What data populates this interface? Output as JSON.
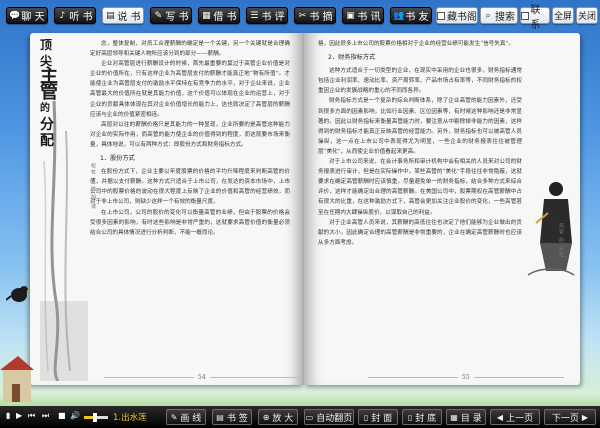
{
  "toolbar": {
    "items": [
      {
        "icon": "💬",
        "label": "聊 天"
      },
      {
        "icon": "♪",
        "label": "听 书"
      },
      {
        "icon": "▤",
        "label": "说 书"
      },
      {
        "icon": "✎",
        "label": "写 书"
      },
      {
        "icon": "▦",
        "label": "借 书"
      },
      {
        "icon": "☰",
        "label": "书 评"
      },
      {
        "icon": "✂",
        "label": "书 摘"
      },
      {
        "icon": "▣",
        "label": "书 讯"
      },
      {
        "icon": "👥",
        "label": "书 友"
      }
    ],
    "bookmark_label": "藏书阁",
    "search_label": "搜索",
    "contact_label": "联系",
    "fullscreen_label": "全屏",
    "close_label": "关闭"
  },
  "book": {
    "left_title": [
      "顶",
      "尖",
      "主",
      "管",
      "的",
      "分",
      "配"
    ],
    "left_side_text": "权杖 下 的 阴 谋",
    "left_paragraphs": [
      "念，整体复制，对员工合理薪酬的确定是一个关键，另一个关键就是合理确定好高层领导和关键人物所应该分到的部分——薪酬。",
      "企业对高管层进行薪酬设计的时候，首先最重要的莫过于高管企业价值是对企业的价值所在，只有这样企业为高管层支付的薪酬才能真正地“物有所值”。才能使企业为高管层支付的激励水平保持在有竞争力的水平，对于企业来说，企业高管最大的价值所在就是其能力价值，这个价值可以体现在企业的运营上，对于企业的贡献具体体现在其对企业价值增长的能力上，这也就决定了高管层的薪酬应该与企业的价值紧密相连。",
      "高层对以往的薪酬价格只是其能力的一种显现，企业所要的是高管这种能力对企业的实际作用，而高管的能力使企业的价值得到的程度，而这就要市场来衡量，具体地说，可以有两种方式：即股份方式和财务指标方式。"
    ],
    "left_heading": "1．股份方式",
    "left_paragraphs_2": [
      "在股份方式下，企业主要以年度股票的价格的平均升降程度来判断高管的价值，并据以支付薪酬。这种方式只适合于上市公司，在发达的资本市场中，上市公司中的股票价格的波动在很大程度上反映了企业的价值和高管的经营绩效，而对于非上市公司，则缺少这样一个有效的衡量尺度。",
      "在上市公司，公司的股价的变化可以衡量高管的业绩，但由于股票的价格会受很多因素的影响，有时这些影响是非常严重的，这就要求高管价值的衡量必须结合公司的具体情况进行分析判断，不能一概而论。"
    ],
    "left_page_num": "54",
    "right_paragraphs_1": [
      "格，因此很多上市公司的股票价格相对于企业的经营业绩可能发生“信号失真”。"
    ],
    "right_heading": "2．财务指标方式",
    "right_paragraphs_2": [
      "这种方式适合于一切类型的企业，在现实中采用的企业也很多，财务指标通常包括企业利润率、速动比率、资产周转率、产品市场占有率等，不同财务指标的权重因企业的发展战略的重心的不同而各异。",
      "财务指标方式是一个复杂的综合判断体系，除了企业高管的能力因素外，还受到很多方面的因素影响，比如行业因素、区位因素等，有时候这种影响还是非常显著的。因此以财务指标来衡量高管能力时，要注意从中剔除掉非能力的因素，这样得到的财务指标才能真正反映高管的经营能力。另外，财务指标也可以被高管人员操纵，这一点在上市公司中表现得尤为明显，一些企业的财务报表往往被管理层“美化”，从而使企业价值看起来更高。",
      "对于上市公司来说，在会计事务所和审计机构中会有相关的人员来对公司的财务报表进行审计，但是在实际操作中，某些高管的“美化”手段往往非常隐蔽，这就要求在确定高管薪酬时应该慎重，尽量避免单一的财务指标，结合多种方式来综合评价，这样才能确定出合理的高管薪酬。在美国公司中，股票期权在高管薪酬中占有很大的比重，在这种激励方式下，高管会更加关注企业股价的变化，一些高管甚至在任期内大肆操纵股价，以谋取自己的利益。",
      "对于企业高管人员来说，其薪酬的高低往往也决定了他们能够为企业做出的贡献的大小，因此确定合理的高管薪酬是非常重要的，企业在确定高管薪酬时也应该从多方面考虑。"
    ],
    "right_page_num": "55",
    "right_side_text": "高管 的 分配"
  },
  "player": {
    "track": "1.出水莲",
    "progress": 0.45
  },
  "bottombar": {
    "draw_label": "画 线",
    "bookmark_label": "书 签",
    "zoom_label": "放 大",
    "autoflip_label": "自动翻页",
    "cover_label": "封 面",
    "backcover_label": "封 底",
    "toc_label": "目 录",
    "prev_label": "上一页",
    "next_label": "下一页"
  }
}
